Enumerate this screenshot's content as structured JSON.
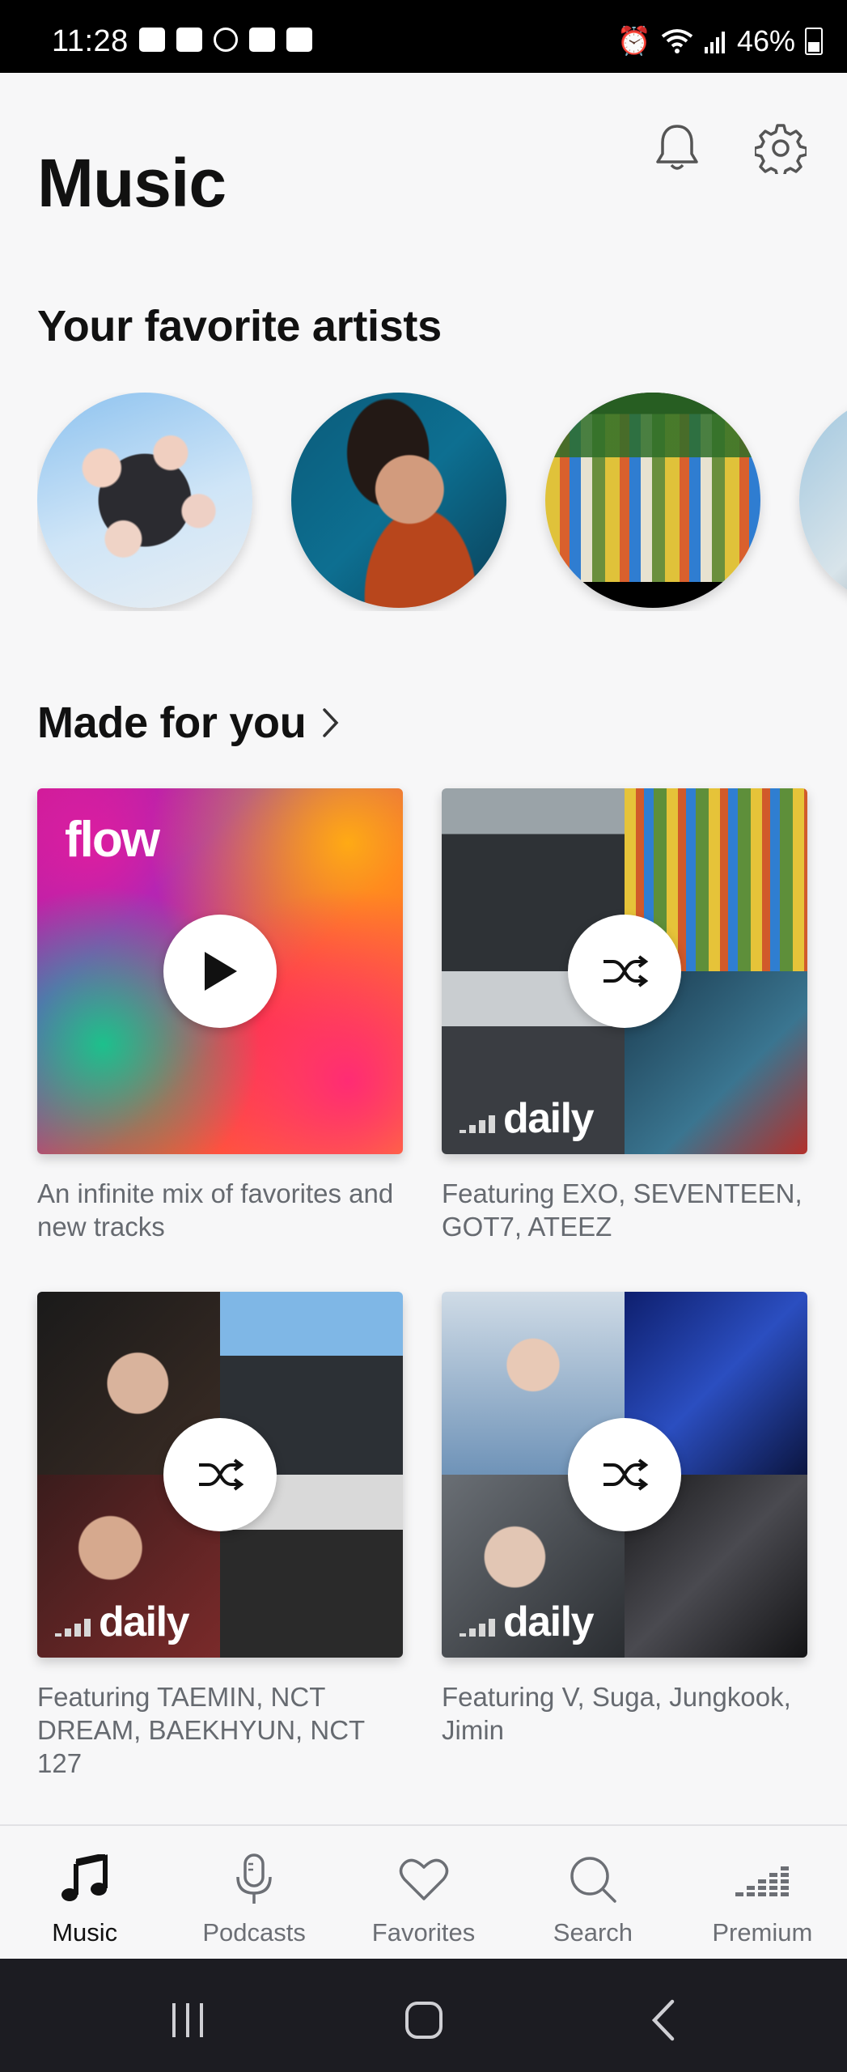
{
  "status_bar": {
    "time": "11:28",
    "battery": "46%",
    "left_icons": [
      "voicemail-icon",
      "voicemail-icon",
      "accessibility-icon",
      "app-icon",
      "gallery-icon"
    ],
    "right_icons": [
      "alarm-icon",
      "wifi-icon",
      "signal-icon",
      "battery-icon"
    ]
  },
  "header": {
    "title": "Music",
    "icons": [
      "bell-icon",
      "gear-icon"
    ]
  },
  "favorites": {
    "title": "Your favorite artists"
  },
  "made_for_you": {
    "title": "Made for you",
    "cards": [
      {
        "logo": "flow",
        "action": "play-icon",
        "description": "An infinite mix of favorites and new tracks"
      },
      {
        "logo": "daily",
        "action": "shuffle-icon",
        "description": "Featuring EXO, SEVENTEEN, GOT7, ATEEZ"
      },
      {
        "logo": "daily",
        "action": "shuffle-icon",
        "description": "Featuring TAEMIN, NCT DREAM, BAEKHYUN, NCT 127"
      },
      {
        "logo": "daily",
        "action": "shuffle-icon",
        "description": "Featuring V, Suga, Jungkook, Jimin"
      }
    ]
  },
  "bottom_nav": {
    "items": [
      {
        "label": "Music",
        "icon": "music-note-icon",
        "active": true
      },
      {
        "label": "Podcasts",
        "icon": "microphone-icon",
        "active": false
      },
      {
        "label": "Favorites",
        "icon": "heart-icon",
        "active": false
      },
      {
        "label": "Search",
        "icon": "search-icon",
        "active": false
      },
      {
        "label": "Premium",
        "icon": "equalizer-icon",
        "active": false
      }
    ]
  },
  "colors": {
    "background": "#f7f7f8",
    "text_primary": "#111111",
    "text_secondary": "#666a70",
    "system_nav": "#1c1c22"
  }
}
